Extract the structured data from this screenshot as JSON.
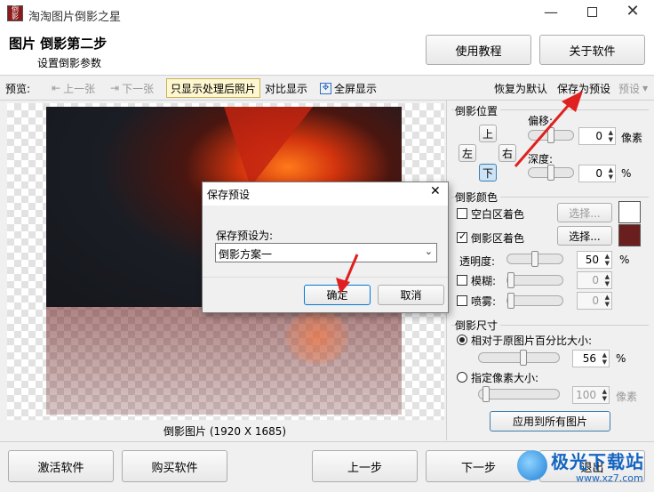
{
  "window": {
    "title": "淘淘图片倒影之星"
  },
  "header": {
    "step_title": "图片 倒影第二步",
    "step_subtitle": "设置倒影参数",
    "tutorial_button": "使用教程",
    "about_button": "关于软件"
  },
  "toolbar": {
    "preview_label": "预览:",
    "prev_label": "上一张",
    "next_label": "下一张",
    "only_processed_label": "只显示处理后照片",
    "compare_label": "对比显示",
    "fullscreen_label": "全屏显示",
    "restore_default_label": "恢复为默认",
    "save_preset_label": "保存为预设",
    "preset_label": "预设"
  },
  "preview": {
    "caption": "倒影图片 (1920 X 1685)"
  },
  "reflection_position": {
    "group_label": "倒影位置",
    "up": "上",
    "left": "左",
    "right": "右",
    "down": "下",
    "offset_label": "偏移:",
    "offset_value": "0",
    "offset_unit": "像素",
    "offset_level": 0.5,
    "depth_label": "深度:",
    "depth_value": "0",
    "depth_unit": "%",
    "depth_level": 0.5
  },
  "reflection_color": {
    "group_label": "倒影颜色",
    "blank_tint_label": "空白区着色",
    "blank_tint_checked": false,
    "blank_tint_color": "#ffffff",
    "reflection_tint_label": "倒影区着色",
    "reflection_tint_checked": true,
    "reflection_tint_color": "#6b1e1e",
    "select_label": "选择...",
    "transparency_label": "透明度:",
    "transparency_value": "50",
    "transparency_unit": "%",
    "transparency_level": 0.5,
    "blur_label": "模糊:",
    "blur_value": "0",
    "blur_level": 0.0,
    "spray_label": "喷雾:",
    "spray_value": "0",
    "spray_level": 0.0
  },
  "reflection_size": {
    "group_label": "倒影尺寸",
    "relative_label": "相对于原图片百分比大小:",
    "relative_selected": true,
    "relative_value": "56",
    "relative_unit": "%",
    "relative_level": 0.56,
    "pixel_label": "指定像素大小:",
    "pixel_value": "100",
    "pixel_unit": "像素",
    "pixel_level": 0.05
  },
  "apply_all_button": "应用到所有图片",
  "footer": {
    "activate_button": "激活软件",
    "buy_button": "购买软件",
    "prev_step_button": "上一步",
    "next_step_button": "下一步",
    "exit_button": "退出"
  },
  "dialog": {
    "title": "保存预设",
    "field_label": "保存预设为:",
    "field_value": "倒影方案一",
    "ok_button": "确定",
    "cancel_button": "取消"
  },
  "watermark": {
    "text_cn": "极光下载站",
    "text_url": "www.xz7.com"
  }
}
